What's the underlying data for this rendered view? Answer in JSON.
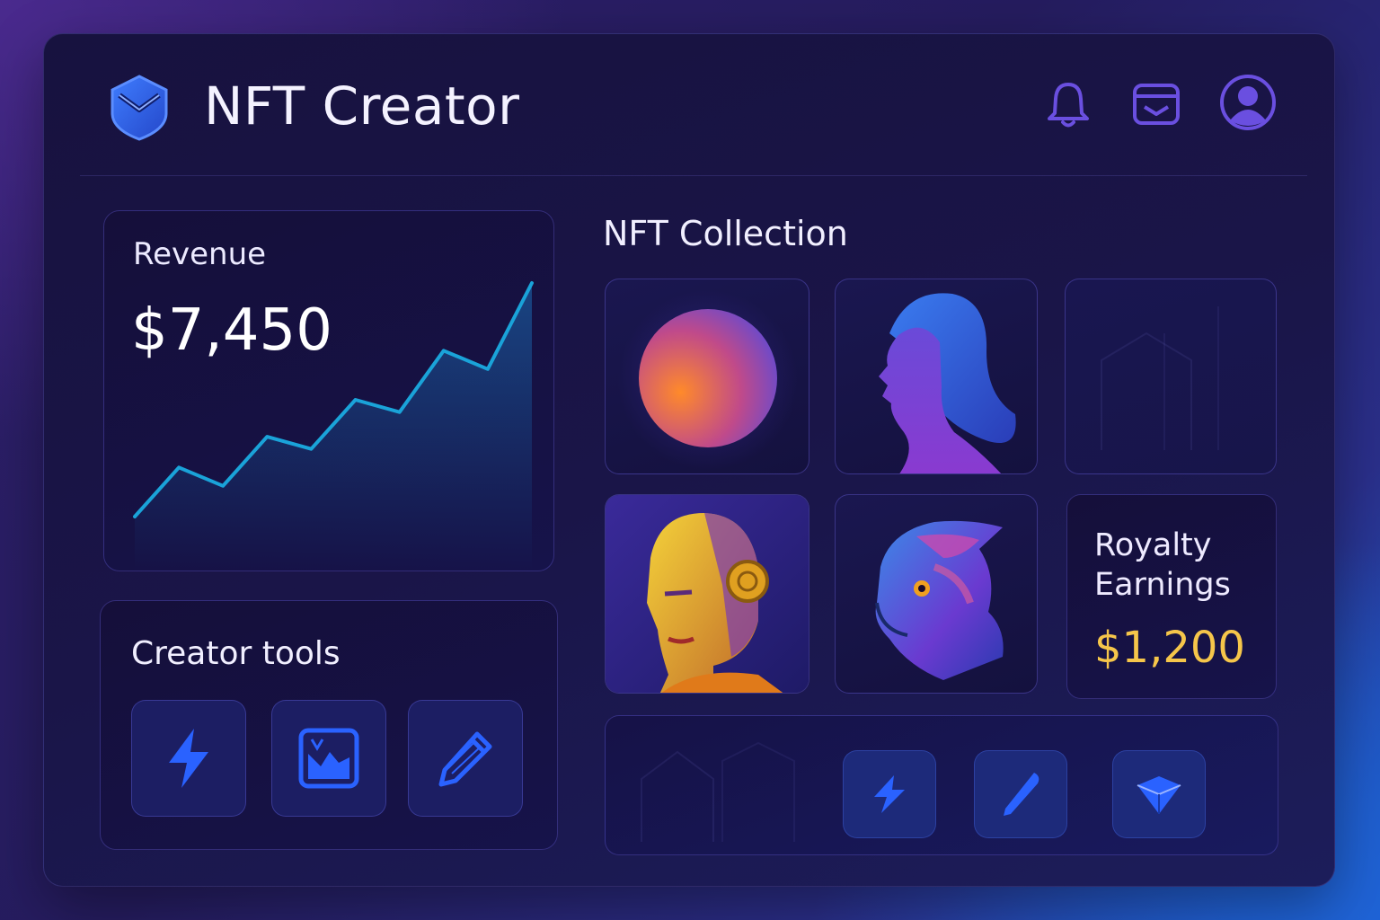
{
  "app": {
    "title": "NFT Creator",
    "logo_icon": "shield-check-icon"
  },
  "header": {
    "actions": [
      {
        "icon": "bell-icon",
        "label": "Notifications"
      },
      {
        "icon": "wallet-icon",
        "label": "Wallet"
      },
      {
        "icon": "user-avatar-icon",
        "label": "Profile"
      }
    ]
  },
  "revenue": {
    "label": "Revenue",
    "value": "$7,450",
    "trend": [
      2,
      18,
      12,
      28,
      24,
      40,
      36,
      56,
      50,
      78
    ]
  },
  "creator_tools": {
    "label": "Creator tools",
    "tools": [
      {
        "icon": "lightning-icon",
        "label": "Quick mint"
      },
      {
        "icon": "image-icon",
        "label": "Image editor"
      },
      {
        "icon": "pencil-icon",
        "label": "Draw"
      }
    ]
  },
  "collection": {
    "label": "NFT Collection",
    "items": [
      {
        "icon": "orb-artwork"
      },
      {
        "icon": "woman-profile-artwork"
      },
      {
        "icon": "empty-slot"
      },
      {
        "icon": "golden-android-artwork"
      },
      {
        "icon": "creature-artwork"
      }
    ]
  },
  "royalty": {
    "label": "Royalty Earnings",
    "value": "$1,200"
  },
  "quick_actions": [
    {
      "icon": "lightning-icon"
    },
    {
      "icon": "brush-icon"
    },
    {
      "icon": "box-icon"
    }
  ],
  "colors": {
    "accent": "#2f6bff",
    "gold": "#f6c64a",
    "chart_line": "#1aa3d9",
    "icon_violet": "#6a4fe0"
  }
}
